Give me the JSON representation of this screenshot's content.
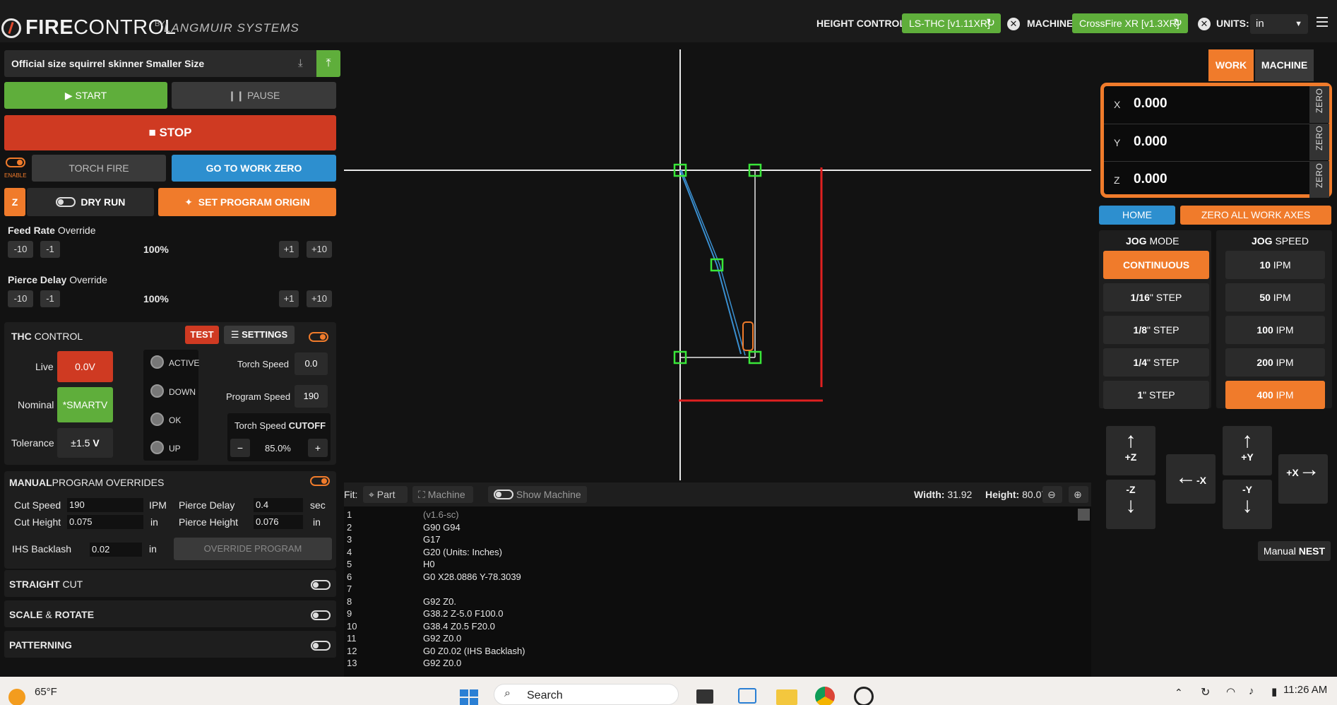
{
  "app": {
    "brand_fire": "FIRE",
    "brand_control": "CONTROL",
    "brand_by": "BY",
    "brand_company": "LANGMUIR SYSTEMS"
  },
  "topbar": {
    "height_control_label": "HEIGHT CONTROL:",
    "height_control_value": "LS-THC [v1.11XR]",
    "machine_label": "MACHINE",
    "machine_value": "CrossFire XR [v1.3XR]",
    "units_label": "UNITS:",
    "units_value": "in"
  },
  "file": {
    "name": "Official size squirrel skinner Smaller  Size"
  },
  "controls": {
    "start": "START",
    "pause": "PAUSE",
    "stop": "STOP",
    "enable": "ENABLE",
    "torch_fire": "TORCH FIRE",
    "go_to_work_zero": "GO TO WORK ZERO",
    "z": "Z",
    "dry_run": "DRY RUN",
    "set_program_origin": "SET PROGRAM ORIGIN"
  },
  "feed_rate": {
    "title": "Feed Rate",
    "sub": "Override",
    "value": "100%",
    "m10": "-10",
    "m1": "-1",
    "p1": "+1",
    "p10": "+10"
  },
  "pierce_delay": {
    "title": "Pierce Delay",
    "sub": "Override",
    "value": "100%",
    "m10": "-10",
    "m1": "-1",
    "p1": "+1",
    "p10": "+10"
  },
  "thc": {
    "title": "THC",
    "sub": "CONTROL",
    "test": "TEST",
    "settings": "SETTINGS",
    "live_label": "Live",
    "live_value": "0.0V",
    "nominal_label": "Nominal",
    "nominal_value": "*SMARTV",
    "tolerance_label": "Tolerance",
    "tolerance_value": "±1.5",
    "tolerance_unit": "V",
    "status": [
      "ACTIVE",
      "DOWN",
      "OK",
      "UP"
    ],
    "torch_speed_label": "Torch Speed",
    "torch_speed_value": "0.0",
    "program_speed_label": "Program Speed",
    "program_speed_value": "190",
    "cutoff_label": "Torch Speed",
    "cutoff_sub": "CUTOFF",
    "cutoff_value": "85.0%",
    "minus": "−",
    "plus": "+"
  },
  "manual": {
    "title": "MANUAL",
    "sub": "PROGRAM OVERRIDES",
    "cut_speed_label": "Cut Speed",
    "cut_speed_value": "190",
    "cut_speed_unit": "IPM",
    "pierce_delay_label": "Pierce Delay",
    "pierce_delay_value": "0.4",
    "pierce_delay_unit": "sec",
    "cut_height_label": "Cut Height",
    "cut_height_value": "0.075",
    "cut_height_unit": "in",
    "pierce_height_label": "Pierce Height",
    "pierce_height_value": "0.076",
    "pierce_height_unit": "in",
    "ihs_label": "IHS Backlash",
    "ihs_value": "0.02",
    "ihs_unit": "in",
    "override_program": "OVERRIDE PROGRAM"
  },
  "options": {
    "straight": "STRAIGHT",
    "straight_sub": "CUT",
    "scale": "SCALE",
    "scale_amp": "&",
    "scale_sub": "ROTATE",
    "patterning": "PATTERNING"
  },
  "fitbar": {
    "fit": "Fit:",
    "part": "Part",
    "machine": "Machine",
    "show_machine": "Show Machine",
    "width_label": "Width:",
    "width_value": "31.92",
    "height_label": "Height:",
    "height_value": "80.07"
  },
  "gcode": [
    {
      "n": "1",
      "t": "(v1.6-sc)"
    },
    {
      "n": "2",
      "t": "G90 G94"
    },
    {
      "n": "3",
      "t": "G17"
    },
    {
      "n": "4",
      "t": "G20 (Units: Inches)"
    },
    {
      "n": "5",
      "t": "H0"
    },
    {
      "n": "6",
      "t": "G0 X28.0886 Y-78.3039"
    },
    {
      "n": "7",
      "t": ""
    },
    {
      "n": "8",
      "t": "G92 Z0."
    },
    {
      "n": "9",
      "t": "G38.2 Z-5.0 F100.0"
    },
    {
      "n": "10",
      "t": "G38.4 Z0.5 F20.0"
    },
    {
      "n": "11",
      "t": "G92 Z0.0"
    },
    {
      "n": "12",
      "t": "G0 Z0.02 (IHS Backlash)"
    },
    {
      "n": "13",
      "t": "G92 Z0.0"
    }
  ],
  "right": {
    "tab_work": "WORK",
    "tab_machine": "MACHINE",
    "axes": [
      {
        "axis": "X",
        "value": "0.000"
      },
      {
        "axis": "Y",
        "value": "0.000"
      },
      {
        "axis": "Z",
        "value": "0.000"
      }
    ],
    "zero": "ZERO",
    "home": "HOME",
    "zero_all": "ZERO ALL WORK AXES",
    "jog_mode_b": "JOG",
    "jog_mode": "MODE",
    "jog_speed_b": "JOG",
    "jog_speed": "SPEED",
    "modes": [
      {
        "b": "CONTINUOUS",
        "s": ""
      },
      {
        "b": "1/16",
        "s": "\" STEP"
      },
      {
        "b": "1/8",
        "s": "\" STEP"
      },
      {
        "b": "1/4",
        "s": "\" STEP"
      },
      {
        "b": "1",
        "s": "\" STEP"
      }
    ],
    "speeds": [
      {
        "b": "10",
        "s": " IPM"
      },
      {
        "b": "50",
        "s": " IPM"
      },
      {
        "b": "100",
        "s": " IPM"
      },
      {
        "b": "200",
        "s": " IPM"
      },
      {
        "b": "400",
        "s": " IPM"
      }
    ],
    "plus_z": "+Z",
    "minus_z": "-Z",
    "minus_x": "-X",
    "plus_y": "+Y",
    "minus_y": "-Y",
    "plus_x": "+X",
    "manual": "Manual",
    "nest": "NEST"
  },
  "taskbar": {
    "temp": "65°F",
    "search": "Search",
    "time": "11:26 AM"
  },
  "colors": {
    "accent_orange": "#f07b2b",
    "green": "#5fae3b",
    "stop_red": "#cf3a22",
    "blue": "#2d8fcf"
  }
}
